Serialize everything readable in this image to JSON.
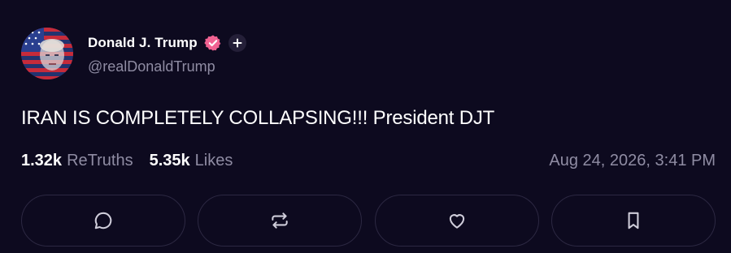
{
  "post": {
    "author": {
      "display_name": "Donald J. Trump",
      "handle": "@realDonaldTrump",
      "avatar_icon": "flag-portrait-avatar",
      "verified_icon": "verified-badge-icon",
      "plus_icon": "plus-badge-icon"
    },
    "text": "IRAN IS COMPLETELY COLLAPSING!!! President DJT",
    "stats": {
      "retruths_count": "1.32k",
      "retruths_label": "ReTruths",
      "likes_count": "5.35k",
      "likes_label": "Likes"
    },
    "timestamp": "Aug 24, 2026, 3:41 PM"
  },
  "actions": [
    {
      "name": "reply",
      "icon": "comment-icon"
    },
    {
      "name": "retruth",
      "icon": "repost-icon"
    },
    {
      "name": "like",
      "icon": "heart-icon"
    },
    {
      "name": "bookmark",
      "icon": "bookmark-icon"
    }
  ],
  "colors": {
    "background": "#0d0a1f",
    "text_primary": "#ffffff",
    "text_secondary": "#8f8ca3",
    "verified": "#f06292",
    "button_border": "#2c2842"
  }
}
